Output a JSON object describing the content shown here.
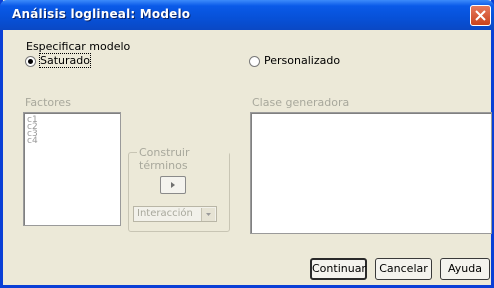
{
  "window": {
    "title": "Análisis loglineal: Modelo"
  },
  "model_section": {
    "label": "Especificar modelo",
    "option_saturated": "Saturado",
    "option_custom": "Personalizado",
    "selected": "Saturado"
  },
  "factors": {
    "label": "Factores",
    "items": [
      "c1",
      "c2",
      "c3",
      "c4"
    ]
  },
  "build_terms": {
    "label": "Construir términos",
    "arrow": "▸",
    "combo_value": "Interacción"
  },
  "generating_class": {
    "label": "Clase generadora",
    "items": []
  },
  "buttons": {
    "continue": "Continuar",
    "cancel": "Cancelar",
    "help": "Ayuda"
  },
  "icons": {
    "close": "close-icon",
    "arrow": "arrow-right-icon",
    "combo": "chevron-down-icon"
  }
}
